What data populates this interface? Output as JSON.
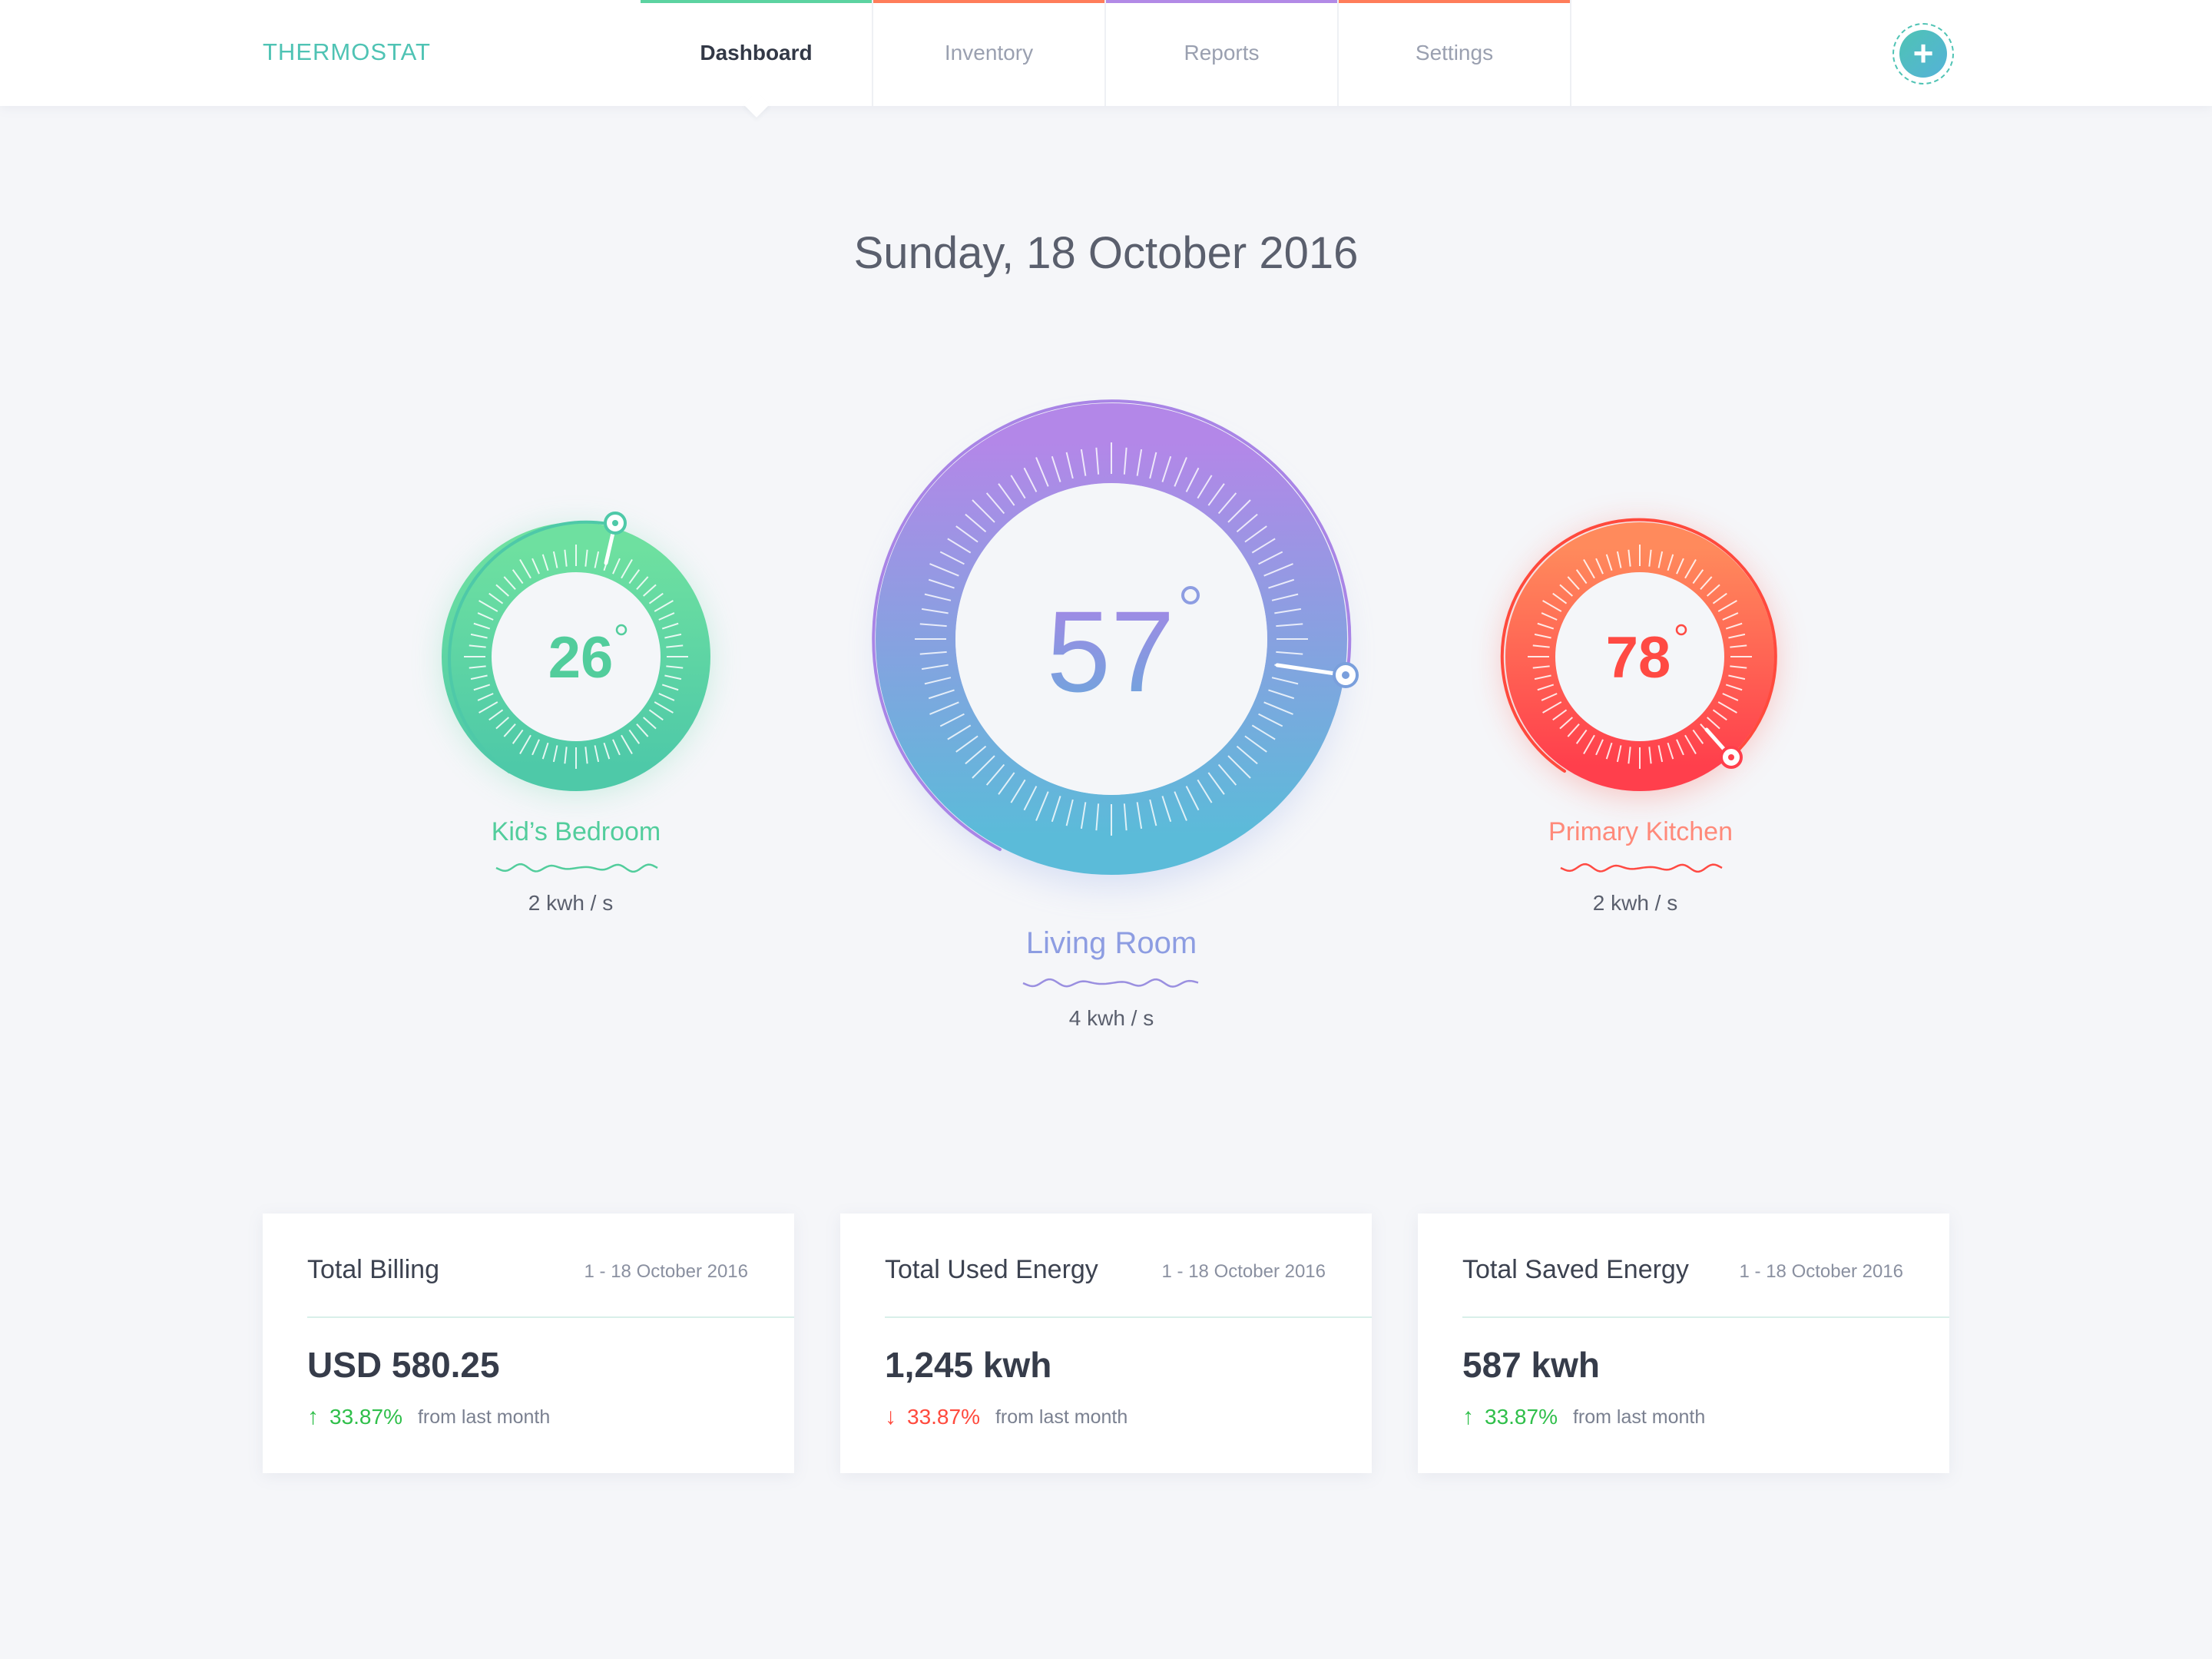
{
  "app": {
    "brand": "THERMOSTAT"
  },
  "nav": {
    "tabs": [
      {
        "label": "Dashboard",
        "color": "#5cd3a1",
        "active": true
      },
      {
        "label": "Inventory",
        "color": "#ff7d5a",
        "active": false
      },
      {
        "label": "Reports",
        "color": "#b28ae6",
        "active": false
      },
      {
        "label": "Settings",
        "color": "#ff7d5a",
        "active": false
      }
    ],
    "add_icon": "plus-icon",
    "add_label": "+"
  },
  "date": "Sunday, 18 October 2016",
  "dials": [
    {
      "room": "Kid’s Bedroom",
      "temperature": "26",
      "degree": "°",
      "usage": "2 kwh / s",
      "colors": [
        "#6ee0a0",
        "#4ec9a8"
      ]
    },
    {
      "room": "Living Room",
      "temperature": "57",
      "degree": "°",
      "usage": "4 kwh / s",
      "colors": [
        "#b387e8",
        "#5bbbd9"
      ]
    },
    {
      "room": "Primary Kitchen",
      "temperature": "78",
      "degree": "°",
      "usage": "2 kwh / s",
      "colors": [
        "#ff8a5c",
        "#ff3f4c"
      ]
    }
  ],
  "cards": [
    {
      "title": "Total Billing",
      "range": "1 - 18 October 2016",
      "value": "USD 580.25",
      "direction": "up",
      "arrow": "↑",
      "change": "33.87%",
      "from": "from last month",
      "change_color": "#2fbf4a"
    },
    {
      "title": "Total Used Energy",
      "range": "1 - 18 October 2016",
      "value": "1,245 kwh",
      "direction": "down",
      "arrow": "↓",
      "change": "33.87%",
      "from": "from last month",
      "change_color": "#ff4a3d"
    },
    {
      "title": "Total Saved Energy",
      "range": "1 - 18 October 2016",
      "value": "587 kwh",
      "direction": "up",
      "arrow": "↑",
      "change": "33.87%",
      "from": "from last month",
      "change_color": "#2fbf4a"
    }
  ]
}
